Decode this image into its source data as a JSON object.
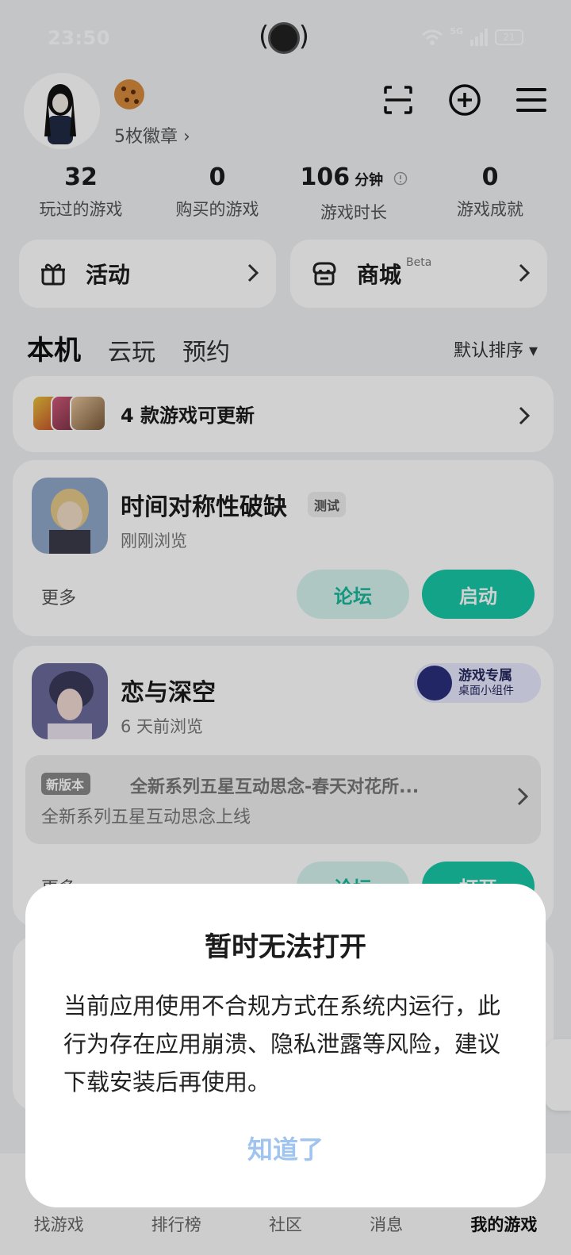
{
  "status_bar": {
    "time": "23:50",
    "network": "5G",
    "battery": "21"
  },
  "header": {
    "badges_text": "5枚徽章 ›",
    "icons": [
      "scan-icon",
      "add-circle-icon",
      "menu-icon"
    ]
  },
  "stats": [
    {
      "value": "32",
      "unit": "",
      "label": "玩过的游戏"
    },
    {
      "value": "0",
      "unit": "",
      "label": "购买的游戏"
    },
    {
      "value": "106",
      "unit": "分钟",
      "label": "游戏时长"
    },
    {
      "value": "0",
      "unit": "",
      "label": "游戏成就"
    }
  ],
  "actions": [
    {
      "label": "活动",
      "icon": "gift-icon"
    },
    {
      "label": "商城",
      "suffix": "Beta",
      "icon": "store-icon"
    }
  ],
  "tabs": [
    {
      "label": "本机",
      "active": true
    },
    {
      "label": "云玩",
      "active": false
    },
    {
      "label": "预约",
      "active": false
    }
  ],
  "sort_label": "默认排序 ▾",
  "update_card": {
    "text": "4 款游戏可更新"
  },
  "games": [
    {
      "name": "时间对称性破缺",
      "tag": "测试",
      "sub": "刚刚浏览",
      "more": "更多",
      "forum_label": "论坛",
      "primary_label": "启动"
    },
    {
      "name": "恋与深空",
      "sub": "6 天前浏览",
      "widget_title": "游戏专属",
      "widget_sub": "桌面小组件",
      "notice_badge": "新版本",
      "notice_title": "全新系列五星互动思念-春天对花所...",
      "notice_sub": "全新系列五星互动思念上线",
      "more": "更多",
      "forum_label": "论坛",
      "primary_label": "打开"
    }
  ],
  "bottom_nav": [
    {
      "label": "找游戏",
      "active": false
    },
    {
      "label": "排行榜",
      "active": false
    },
    {
      "label": "社区",
      "active": false
    },
    {
      "label": "消息",
      "active": false
    },
    {
      "label": "我的游戏",
      "active": true
    }
  ],
  "dialog": {
    "title": "暂时无法打开",
    "message": "当前应用使用不合规方式在系统内运行，此行为存在应用崩溃、隐私泄露等风险，建议下载安装后再使用。",
    "button": "知道了"
  },
  "colors": {
    "accent": "#16c7a6",
    "accent_light": "#d6f3ee",
    "dialog_button": "#9fc4f0"
  }
}
